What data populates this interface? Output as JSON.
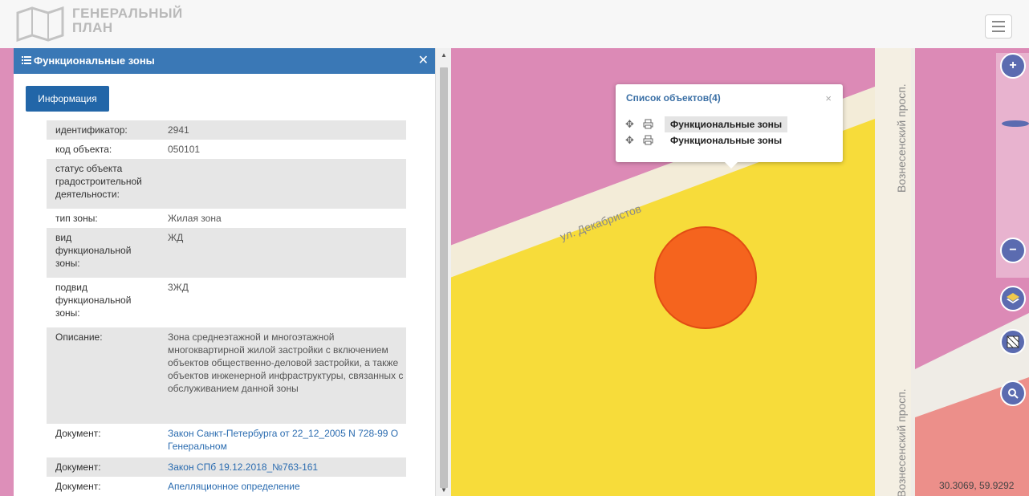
{
  "header": {
    "logo_line1": "ГЕНЕРАЛЬНЫЙ",
    "logo_line2": "ПЛАН"
  },
  "panel": {
    "title": "Функциональные зоны",
    "info_tab": "Информация",
    "rows": [
      {
        "key": "идентификатор:",
        "value": "2941"
      },
      {
        "key": "код объекта:",
        "value": "050101"
      },
      {
        "key": "статус объекта градостроительной деятельности:",
        "value": ""
      },
      {
        "key": "тип зоны:",
        "value": "Жилая зона"
      },
      {
        "key": "вид функциональной зоны:",
        "value": "ЖД"
      },
      {
        "key": "подвид функциональной зоны:",
        "value": "3ЖД"
      },
      {
        "key": "Описание:",
        "value": "Зона среднеэтажной и многоэтажной многоквартирной жилой застройки с включением объектов общественно-деловой застройки, а также объектов инженерной инфраструктуры, связанных с обслуживанием данной зоны"
      },
      {
        "key": "Документ:",
        "value": "Закон Санкт-Петербурга от 22_12_2005 N 728-99 О Генеральном"
      },
      {
        "key": "Документ:",
        "value": "Закон СПб 19.12.2018_№763-161"
      },
      {
        "key": "Документ:",
        "value": "Апелляционное определение"
      }
    ]
  },
  "popup": {
    "title": "Список объектов(4)",
    "items": [
      "Функциональные зоны",
      "Функциональные зоны"
    ]
  },
  "map": {
    "street_dekabristov": "ул. Декабристов",
    "street_voznesensky_top": "Вознесенский просп.",
    "street_voznesensky_bottom": "Вознесенский просп.",
    "coords": "30.3069, 59.9292"
  },
  "controls": {
    "zoom_in": "+",
    "zoom_out": "−"
  },
  "colors": {
    "zone_residential": "#f7dc3a",
    "zone_pink": "#d97fb0",
    "zone_salmon": "#ec8f8a",
    "marker": "#f55a1c",
    "panel_header": "#3a78b6",
    "control": "#5b6bb0"
  }
}
